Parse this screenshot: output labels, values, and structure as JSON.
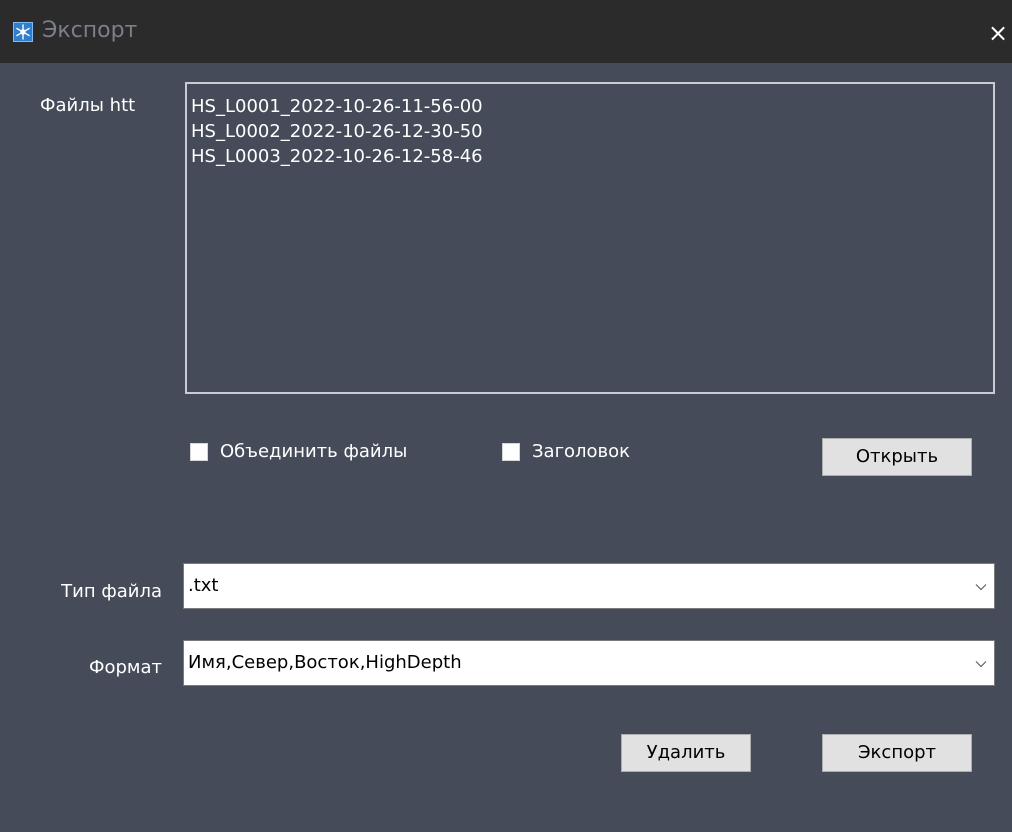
{
  "window": {
    "title": "Экспорт",
    "close_symbol": "×",
    "icon": "app-snowflake-icon"
  },
  "files": {
    "label": "Файлы htt",
    "items": [
      "HS_L0001_2022-10-26-11-56-00",
      "HS_L0002_2022-10-26-12-30-50",
      "HS_L0003_2022-10-26-12-58-46"
    ]
  },
  "options": {
    "merge_label": "Объединить файлы",
    "merge_checked": false,
    "header_label": "Заголовок",
    "header_checked": false
  },
  "buttons": {
    "open": "Открыть",
    "delete": "Удалить",
    "export": "Экспорт"
  },
  "file_type": {
    "label": "Тип файла",
    "value": ".txt"
  },
  "format": {
    "label": "Формат",
    "value": "Имя,Север,Восток,HighDepth"
  },
  "colors": {
    "window_bg": "#454b59",
    "titlebar_bg": "#2b2b2b",
    "title_text": "#7b7f87",
    "button_bg": "#e1e1e1"
  }
}
